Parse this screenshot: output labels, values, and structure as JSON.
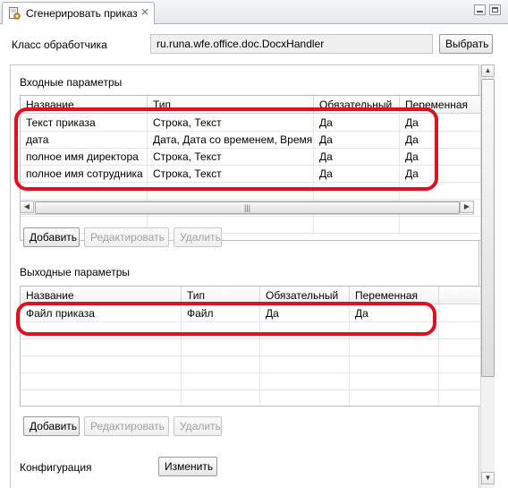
{
  "tab": {
    "title": "Сгенерировать приказ",
    "close_glyph": "⨯",
    "icon": "document-gear-icon"
  },
  "handler": {
    "label": "Класс обработчика",
    "value": "ru.runa.wfe.office.doc.DocxHandler",
    "choose_button": "Выбрать"
  },
  "input_params": {
    "section_title": "Входные параметры",
    "columns": [
      "Название",
      "Тип",
      "Обязательный",
      "Переменная"
    ],
    "rows": [
      [
        "Текст приказа",
        "Строка, Текст",
        "Да",
        "Да"
      ],
      [
        "дата",
        "Дата, Дата со временем, Время",
        "Да",
        "Да"
      ],
      [
        "полное имя директора",
        "Строка, Текст",
        "Да",
        "Да"
      ],
      [
        "полное имя сотрудника",
        "Строка, Текст",
        "Да",
        "Да"
      ]
    ],
    "buttons": {
      "add": "Добавить",
      "edit": "Редактировать",
      "delete": "Удалить"
    }
  },
  "output_params": {
    "section_title": "Выходные параметры",
    "columns": [
      "Название",
      "Тип",
      "Обязательный",
      "Переменная"
    ],
    "rows": [
      [
        "Файл приказа",
        "Файл",
        "Да",
        "Да"
      ]
    ],
    "buttons": {
      "add": "Добавить",
      "edit": "Редактировать",
      "delete": "Удалить"
    }
  },
  "config": {
    "label": "Конфигурация",
    "change_button": "Изменить"
  },
  "colors": {
    "annotation_red": "#e0101d",
    "field_bg": "#efefef"
  }
}
